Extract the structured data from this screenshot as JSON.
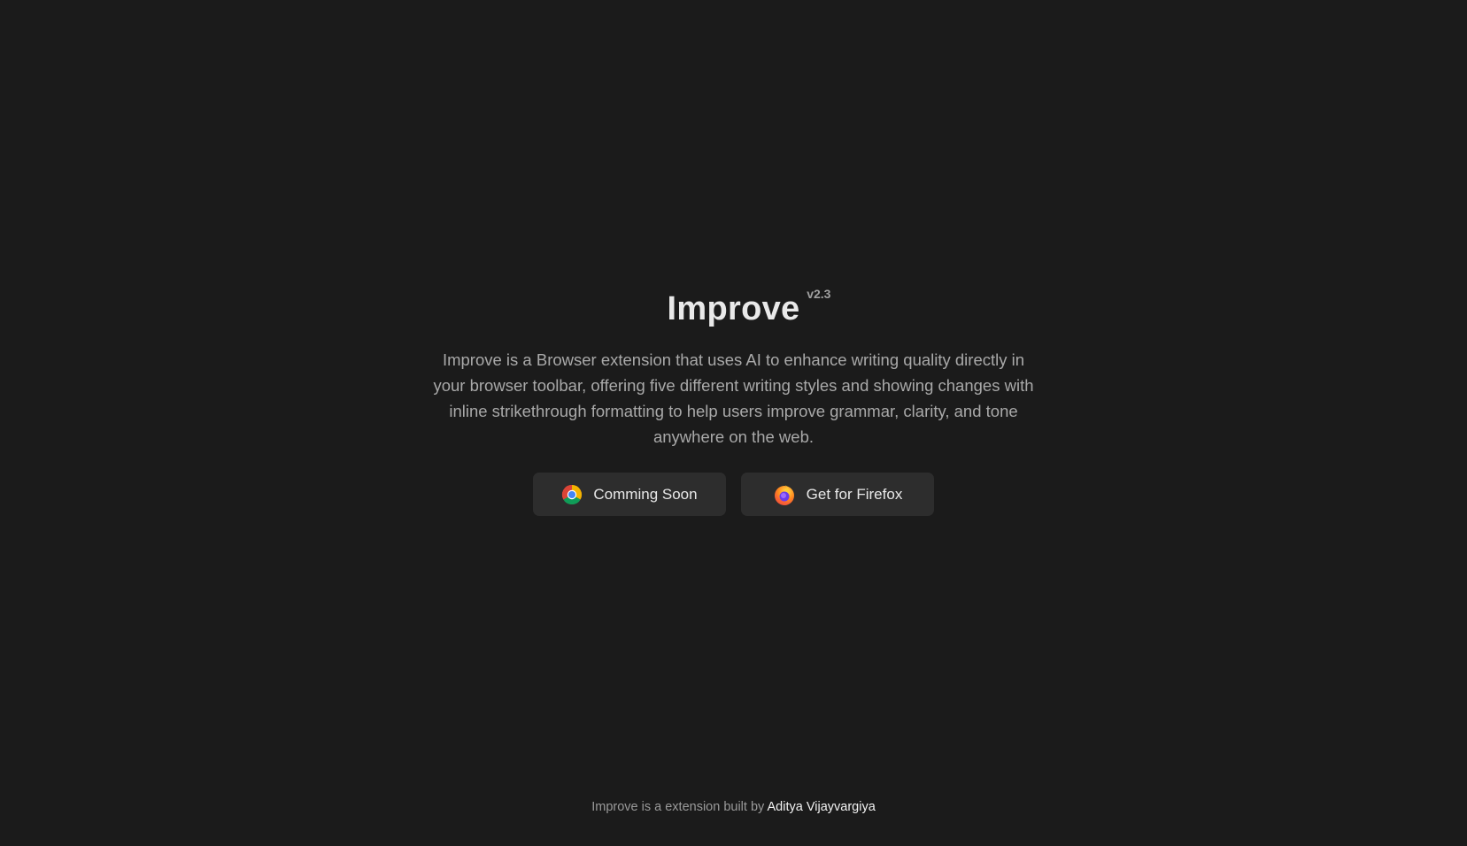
{
  "hero": {
    "title": "Improve",
    "version": "v2.3",
    "description": "Improve is a Browser extension that uses AI to enhance writing quality directly in your browser toolbar, offering five different writing styles and showing changes with inline strikethrough formatting to help users improve grammar, clarity, and tone anywhere on the web."
  },
  "buttons": {
    "chrome": {
      "label": "Comming Soon",
      "icon": "chrome-icon"
    },
    "firefox": {
      "label": "Get for Firefox",
      "icon": "firefox-icon"
    }
  },
  "footer": {
    "text": "Improve is a extension built by ",
    "author": "Aditya Vijayvargiya"
  },
  "colors": {
    "background": "#1b1b1b",
    "button_background": "#2d2d2d",
    "title": "#e9e9e9",
    "description": "#a9a9a9"
  }
}
